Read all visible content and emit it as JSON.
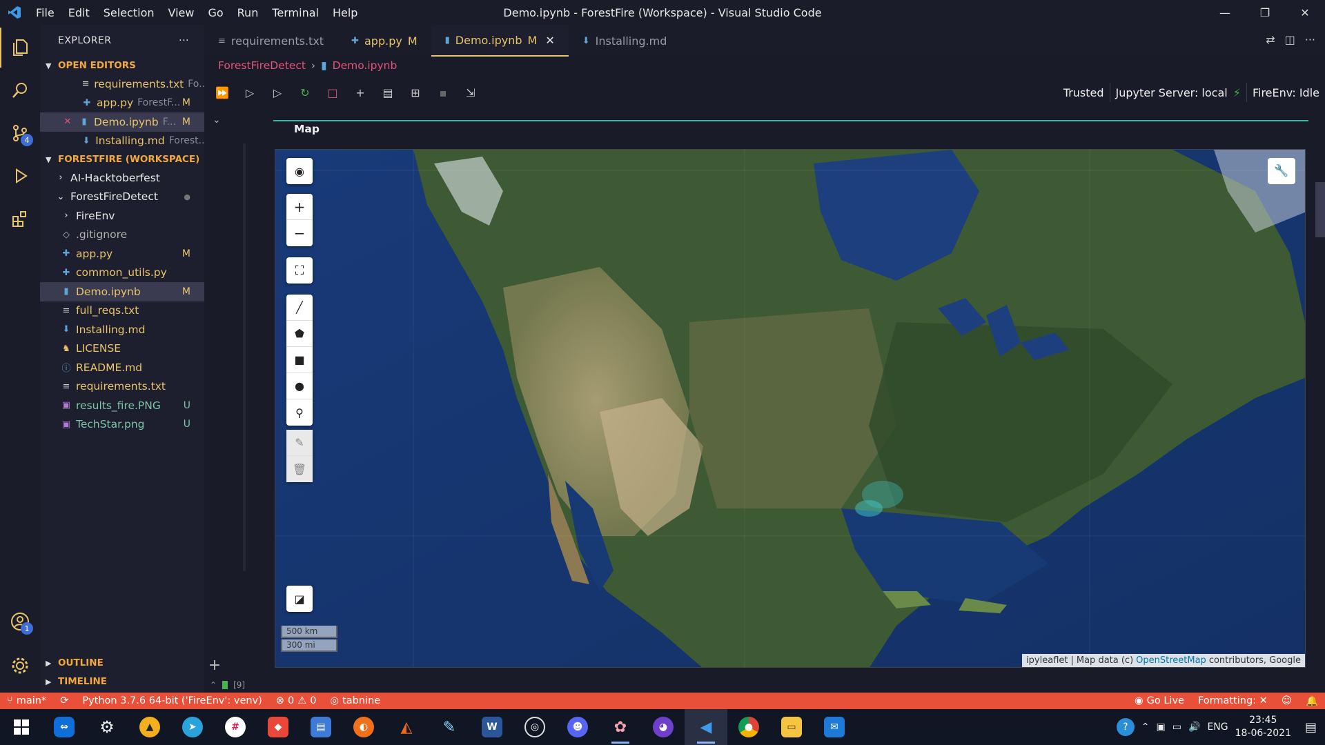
{
  "window": {
    "title": "Demo.ipynb - ForestFire (Workspace) - Visual Studio Code",
    "menu": [
      "File",
      "Edit",
      "Selection",
      "View",
      "Go",
      "Run",
      "Terminal",
      "Help"
    ]
  },
  "activity": {
    "scm_badge": "4",
    "accounts_badge": "1"
  },
  "sidebar": {
    "title": "EXPLORER",
    "more": "···",
    "open_editors": {
      "label": "OPEN EDITORS",
      "items": [
        {
          "name": "requirements.txt",
          "desc": "Fo...",
          "status": ""
        },
        {
          "name": "app.py",
          "desc": "ForestF...",
          "status": "M"
        },
        {
          "name": "Demo.ipynb",
          "desc": "F...",
          "status": "M"
        },
        {
          "name": "Installing.md",
          "desc": "Forest...",
          "status": ""
        }
      ]
    },
    "workspace": {
      "label": "FORESTFIRE (WORKSPACE)",
      "items": [
        {
          "name": "AI-Hacktoberfest",
          "status": ""
        },
        {
          "name": "ForestFireDetect",
          "status": "●"
        },
        {
          "name": "FireEnv",
          "status": ""
        },
        {
          "name": ".gitignore",
          "status": ""
        },
        {
          "name": "app.py",
          "status": "M"
        },
        {
          "name": "common_utils.py",
          "status": ""
        },
        {
          "name": "Demo.ipynb",
          "status": "M"
        },
        {
          "name": "full_reqs.txt",
          "status": ""
        },
        {
          "name": "Installing.md",
          "status": ""
        },
        {
          "name": "LICENSE",
          "status": ""
        },
        {
          "name": "README.md",
          "status": ""
        },
        {
          "name": "requirements.txt",
          "status": ""
        },
        {
          "name": "results_fire.PNG",
          "status": "U"
        },
        {
          "name": "TechStar.png",
          "status": "U"
        }
      ]
    },
    "outline": "OUTLINE",
    "timeline": "TIMELINE"
  },
  "tabs": [
    {
      "label": "requirements.txt",
      "mod": ""
    },
    {
      "label": "app.py",
      "mod": "M"
    },
    {
      "label": "Demo.ipynb",
      "mod": "M"
    },
    {
      "label": "Installing.md",
      "mod": ""
    }
  ],
  "breadcrumb": [
    "ForestFireDetect",
    "Demo.ipynb"
  ],
  "notebook": {
    "trusted": "Trusted",
    "server": "Jupyter Server: local",
    "kernel": "FireEnv: Idle",
    "cell_label": "Map",
    "exec_count": "[9]"
  },
  "map": {
    "scale_km": "500 km",
    "scale_mi": "300 mi",
    "attr_lib": "ipyleaflet",
    "attr_sep": "|",
    "attr_data": "Map data (c)",
    "attr_link": "OpenStreetMap",
    "attr_rest": "contributors, Google"
  },
  "statusbar": {
    "branch": "main*",
    "python": "Python 3.7.6 64-bit ('FireEnv': venv)",
    "errors": "0",
    "warnings": "0",
    "tabnine": "tabnine",
    "golive": "Go Live",
    "formatting": "Formatting: ✕"
  },
  "taskbar": {
    "lang": "ENG",
    "time": "23:45",
    "date": "18-06-2021"
  },
  "colors": {
    "accent": "#e8c46a",
    "statusbar": "#e8503a",
    "error_text": "#e0557a",
    "cell_rule": "#2fb7a3"
  }
}
